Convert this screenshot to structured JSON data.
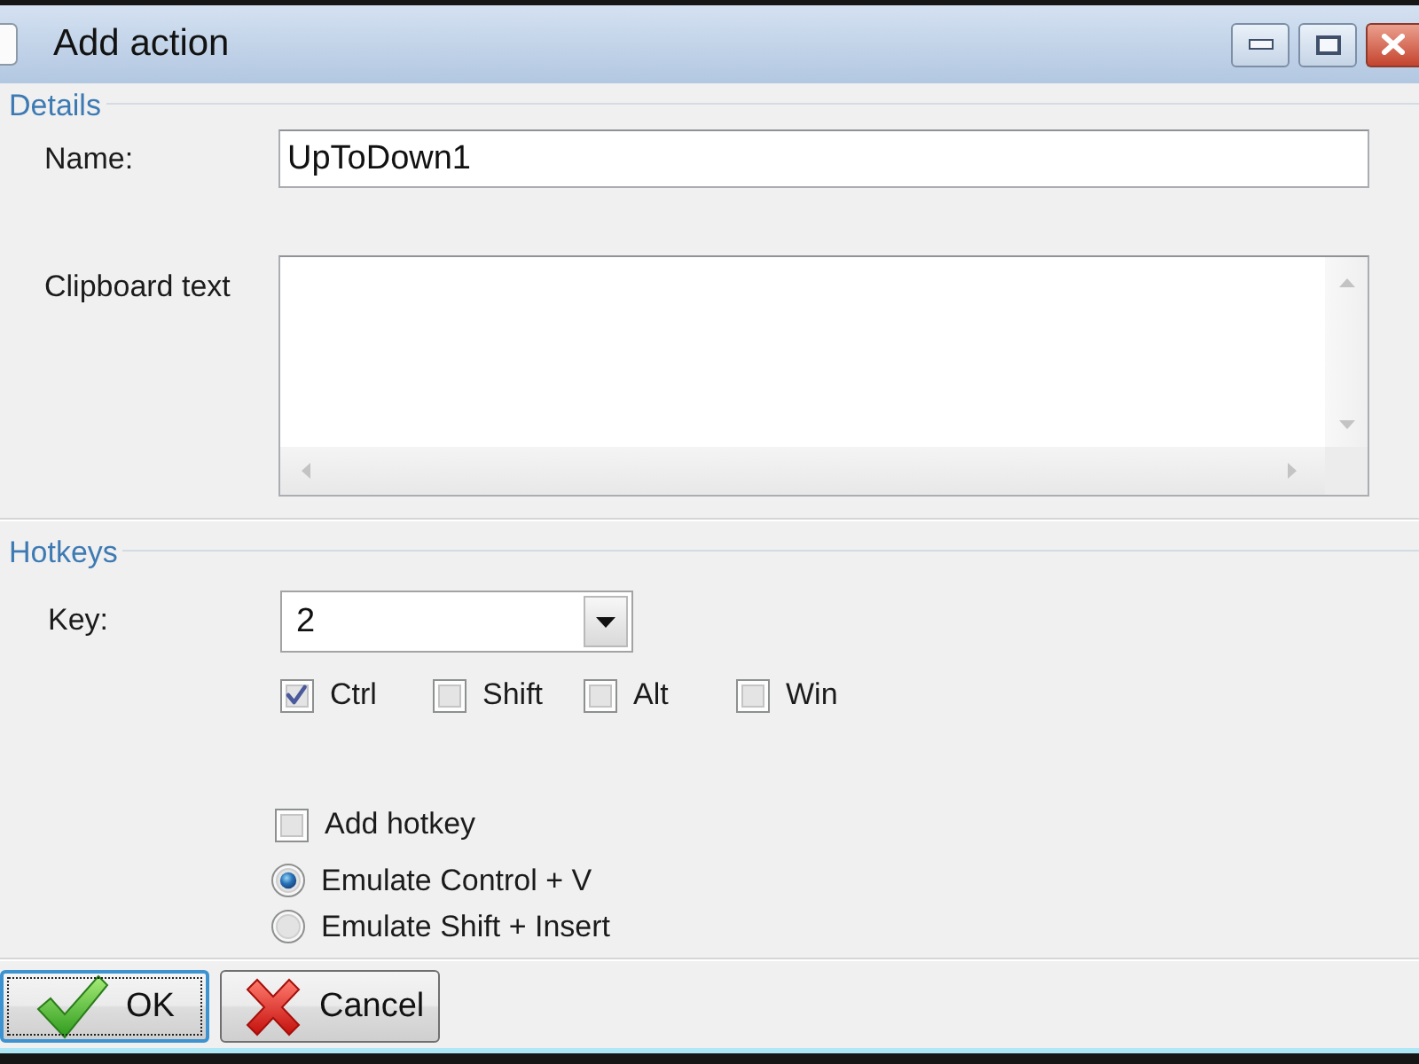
{
  "window": {
    "title": "Add action"
  },
  "details": {
    "title": "Details",
    "name": {
      "label": "Name:",
      "value": "UpToDown1"
    },
    "clipboard_text": {
      "label": "Clipboard text"
    }
  },
  "hotkeys": {
    "title": "Hotkeys",
    "key": {
      "label": "Key:",
      "value": "2"
    },
    "modifiers": [
      {
        "label": "Ctrl",
        "checked": true
      },
      {
        "label": "Shift",
        "checked": false
      },
      {
        "label": "Alt",
        "checked": false
      },
      {
        "label": "Win",
        "checked": false
      }
    ],
    "add_hotkey": {
      "label": "Add hotkey",
      "checked": false
    },
    "emulation": [
      {
        "label": "Emulate Control + V",
        "selected": true
      },
      {
        "label": "Emulate Shift + Insert",
        "selected": false
      }
    ]
  },
  "buttons": [
    {
      "kind": "ok",
      "label": "OK",
      "focused": true
    },
    {
      "kind": "cancel",
      "label": "Cancel",
      "focused": false
    }
  ]
}
